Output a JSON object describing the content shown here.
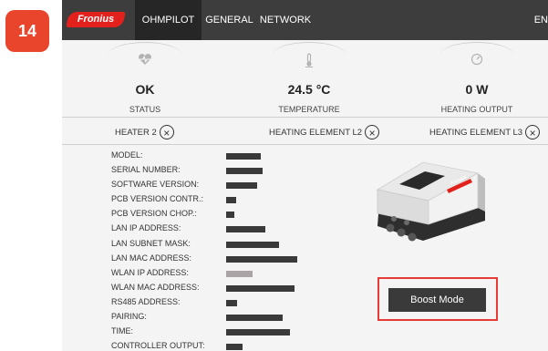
{
  "step_badge": "14",
  "nav": {
    "logo": "Fronius",
    "tabs": [
      {
        "label": "OHMPILOT",
        "active": true
      },
      {
        "label": "GENERAL",
        "active": false
      },
      {
        "label": "NETWORK",
        "active": false
      }
    ],
    "language": "EN"
  },
  "metrics": [
    {
      "icon": "heartbeat-icon",
      "value": "OK",
      "label": "STATUS"
    },
    {
      "icon": "thermometer-icon",
      "value": "24.5 °C",
      "label": "TEMPERATURE"
    },
    {
      "icon": "gauge-icon",
      "value": "0 W",
      "label": "HEATING OUTPUT"
    }
  ],
  "heaters": [
    {
      "label": "HEATER 2"
    },
    {
      "label": "HEATING ELEMENT L2"
    },
    {
      "label": "HEATING ELEMENT L3"
    }
  ],
  "info": {
    "labels": [
      "MODEL:",
      "SERIAL NUMBER:",
      "SOFTWARE VERSION:",
      "PCB VERSION CONTR.:",
      "PCB VERSION CHOP.:",
      "LAN IP ADDRESS:",
      "LAN SUBNET MASK:",
      "LAN MAC ADDRESS:",
      "WLAN IP ADDRESS:",
      "WLAN MAC ADDRESS:",
      "RS485 ADDRESS:",
      "PAIRING:",
      "TIME:",
      "CONTROLLER OUTPUT:"
    ],
    "redacted": true
  },
  "device_logo": "Fronius",
  "boost_button": "Boost Mode",
  "colors": {
    "accent": "#e2211c",
    "nav_bg": "#3d3d3d",
    "highlight": "#e63a37",
    "button_bg": "#3a3a3a"
  }
}
